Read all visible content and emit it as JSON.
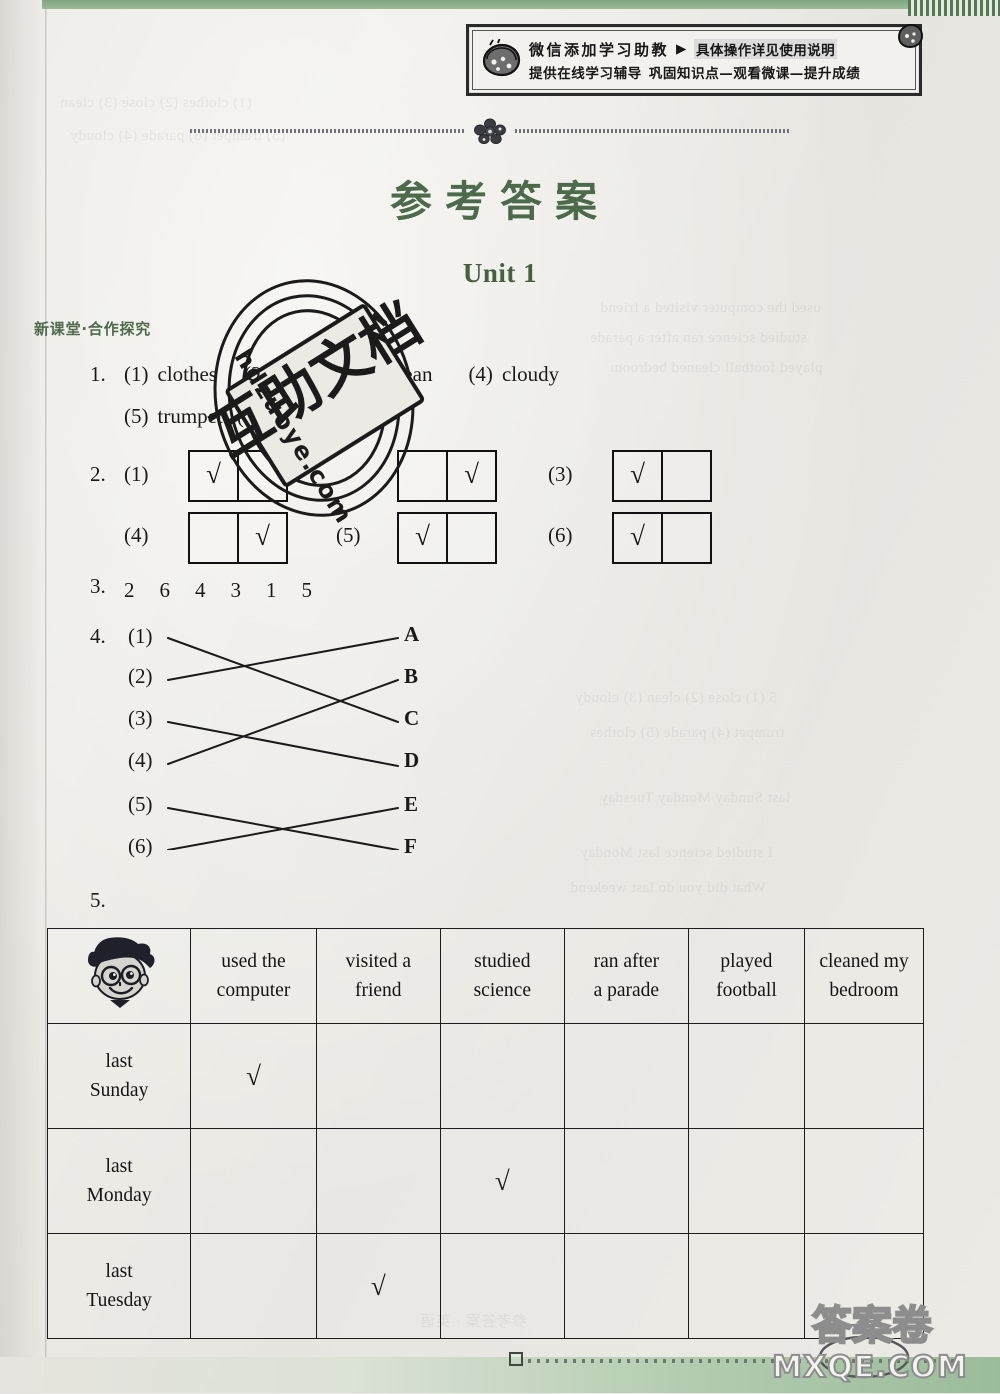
{
  "page": {
    "title": "参考答案",
    "unit": "Unit 1",
    "section_label": "新课堂·合作探究"
  },
  "promo_banner": {
    "icon": "bread-icon",
    "line1_main": "微信添加学习助教",
    "line1_arrow": "▶",
    "line1_highlight": "具体操作详见使用说明",
    "line2_left": "提供在线学习辅导",
    "line2_right": "巩固知识点—观看微课—提升成绩",
    "badge": "corner-badge-icon"
  },
  "answers": {
    "q1": {
      "number": "1.",
      "line1": [
        {
          "label": "(1)",
          "word": "clothes"
        },
        {
          "label": "(2)",
          "word": "close"
        },
        {
          "label": "(3)",
          "word": "clean"
        },
        {
          "label": "(4)",
          "word": "cloudy"
        }
      ],
      "line2": [
        {
          "label": "(5)",
          "word": "trumpet"
        },
        {
          "label": "(6)",
          "word": "parade"
        }
      ]
    },
    "q2": {
      "number": "2.",
      "items": [
        {
          "label": "(1)",
          "checked": "left",
          "mark": "√"
        },
        {
          "label": "(2)",
          "checked": "right",
          "mark": "√"
        },
        {
          "label": "(3)",
          "checked": "left",
          "mark": "√"
        },
        {
          "label": "(4)",
          "checked": "right",
          "mark": "√"
        },
        {
          "label": "(5)",
          "checked": "left",
          "mark": "√"
        },
        {
          "label": "(6)",
          "checked": "left",
          "mark": "√"
        }
      ]
    },
    "q3": {
      "number": "3.",
      "sequence": "2　6　4　3　1　5"
    },
    "q4": {
      "number": "4.",
      "left_labels": [
        "(1)",
        "(2)",
        "(3)",
        "(4)",
        "(5)",
        "(6)"
      ],
      "right_labels": [
        "A",
        "B",
        "C",
        "D",
        "E",
        "F"
      ],
      "pairs": [
        {
          "from": "(1)",
          "to": "C"
        },
        {
          "from": "(2)",
          "to": "A"
        },
        {
          "from": "(3)",
          "to": "D"
        },
        {
          "from": "(4)",
          "to": "B"
        },
        {
          "from": "(5)",
          "to": "F"
        },
        {
          "from": "(6)",
          "to": "E"
        }
      ]
    },
    "q5": {
      "number": "5.",
      "table": {
        "corner_icon": "boy-face-icon",
        "columns": [
          {
            "l1": "used the",
            "l2": "computer"
          },
          {
            "l1": "visited a",
            "l2": "friend"
          },
          {
            "l1": "studied",
            "l2": "science"
          },
          {
            "l1": "ran after",
            "l2": "a parade"
          },
          {
            "l1": "played",
            "l2": "football"
          },
          {
            "l1": "cleaned my",
            "l2": "bedroom"
          }
        ],
        "rows": [
          {
            "l1": "last",
            "l2": "Sunday",
            "checks": [
              "√",
              "",
              "",
              "",
              "",
              ""
            ]
          },
          {
            "l1": "last",
            "l2": "Monday",
            "checks": [
              "",
              "",
              "√",
              "",
              "",
              ""
            ]
          },
          {
            "l1": "last",
            "l2": "Tuesday",
            "checks": [
              "",
              "√",
              "",
              "",
              "",
              ""
            ]
          }
        ]
      }
    }
  },
  "watermarks": {
    "stamp_cn": "互助文档",
    "stamp_url": "hdzuoye.com",
    "bottom_cn": "答案卷",
    "bottom_url": "MXQE.COM"
  },
  "colors": {
    "title_green": "#4c6b4b",
    "strip_green": "#7ea57f",
    "ink": "#1a1a1a"
  }
}
